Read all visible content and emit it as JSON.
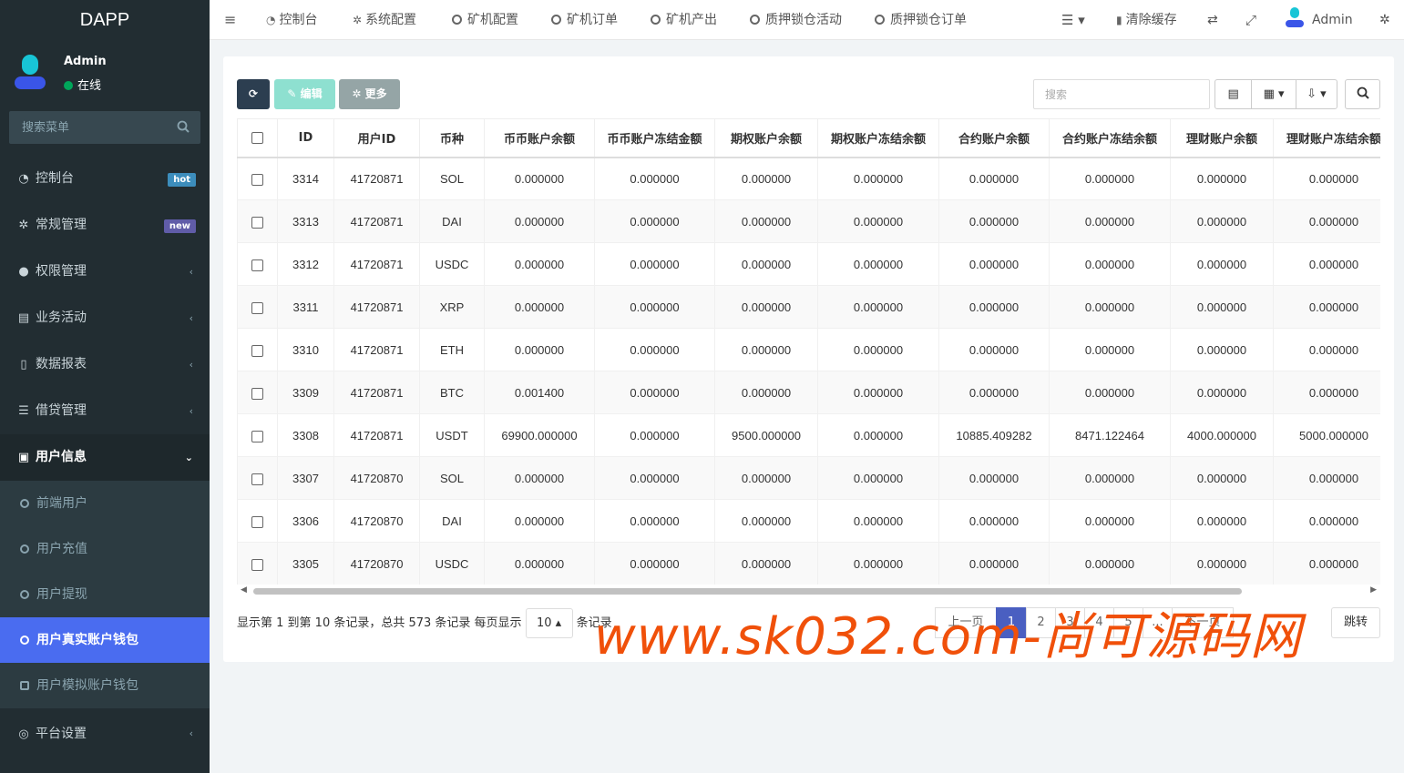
{
  "brand": "DAPP",
  "user": {
    "name": "Admin",
    "status": "在线"
  },
  "sidebar": {
    "search_placeholder": "搜索菜单",
    "items": [
      {
        "label": "控制台",
        "icon": "dashboard-icon",
        "badge": "hot",
        "badge_color": "#3c8dbc"
      },
      {
        "label": "常规管理",
        "icon": "cogs-icon",
        "badge": "new",
        "badge_color": "#605ca8"
      },
      {
        "label": "权限管理",
        "icon": "group-icon"
      },
      {
        "label": "业务活动",
        "icon": "list-alt-icon"
      },
      {
        "label": "数据报表",
        "icon": "file-icon"
      },
      {
        "label": "借贷管理",
        "icon": "list-icon"
      },
      {
        "label": "用户信息",
        "icon": "user-card-icon"
      }
    ],
    "sub_items": [
      {
        "label": "前端用户"
      },
      {
        "label": "用户充值"
      },
      {
        "label": "用户提现"
      },
      {
        "label": "用户真实账户钱包"
      },
      {
        "label": "用户模拟账户钱包"
      }
    ],
    "bottom_item": {
      "label": "平台设置"
    }
  },
  "topnav": {
    "items": [
      "控制台",
      "系统配置",
      "矿机配置",
      "矿机订单",
      "矿机产出",
      "质押锁仓活动",
      "质押锁仓订单"
    ],
    "clear_cache": "清除缓存",
    "admin": "Admin"
  },
  "toolbar": {
    "edit_label": "编辑",
    "more_label": "更多",
    "search_placeholder": "搜索"
  },
  "table": {
    "columns": [
      "ID",
      "用户ID",
      "币种",
      "币币账户余额",
      "币币账户冻结金额",
      "期权账户余额",
      "期权账户冻结余额",
      "合约账户余额",
      "合约账户冻结余额",
      "理财账户余额",
      "理财账户冻结余额"
    ],
    "rows": [
      [
        "3314",
        "41720871",
        "SOL",
        "0.000000",
        "0.000000",
        "0.000000",
        "0.000000",
        "0.000000",
        "0.000000",
        "0.000000",
        "0.000000"
      ],
      [
        "3313",
        "41720871",
        "DAI",
        "0.000000",
        "0.000000",
        "0.000000",
        "0.000000",
        "0.000000",
        "0.000000",
        "0.000000",
        "0.000000"
      ],
      [
        "3312",
        "41720871",
        "USDC",
        "0.000000",
        "0.000000",
        "0.000000",
        "0.000000",
        "0.000000",
        "0.000000",
        "0.000000",
        "0.000000"
      ],
      [
        "3311",
        "41720871",
        "XRP",
        "0.000000",
        "0.000000",
        "0.000000",
        "0.000000",
        "0.000000",
        "0.000000",
        "0.000000",
        "0.000000"
      ],
      [
        "3310",
        "41720871",
        "ETH",
        "0.000000",
        "0.000000",
        "0.000000",
        "0.000000",
        "0.000000",
        "0.000000",
        "0.000000",
        "0.000000"
      ],
      [
        "3309",
        "41720871",
        "BTC",
        "0.001400",
        "0.000000",
        "0.000000",
        "0.000000",
        "0.000000",
        "0.000000",
        "0.000000",
        "0.000000"
      ],
      [
        "3308",
        "41720871",
        "USDT",
        "69900.000000",
        "0.000000",
        "9500.000000",
        "0.000000",
        "10885.409282",
        "8471.122464",
        "4000.000000",
        "5000.000000"
      ],
      [
        "3307",
        "41720870",
        "SOL",
        "0.000000",
        "0.000000",
        "0.000000",
        "0.000000",
        "0.000000",
        "0.000000",
        "0.000000",
        "0.000000"
      ],
      [
        "3306",
        "41720870",
        "DAI",
        "0.000000",
        "0.000000",
        "0.000000",
        "0.000000",
        "0.000000",
        "0.000000",
        "0.000000",
        "0.000000"
      ],
      [
        "3305",
        "41720870",
        "USDC",
        "0.000000",
        "0.000000",
        "0.000000",
        "0.000000",
        "0.000000",
        "0.000000",
        "0.000000",
        "0.000000"
      ]
    ]
  },
  "footer": {
    "info_prefix": "显示第 1 到第 10 条记录，总共 573 条记录 每页显示",
    "page_size": "10",
    "info_suffix": "条记录",
    "pager": [
      "上一页",
      "1",
      "2",
      "3",
      "4",
      "5",
      "...",
      "下一页"
    ],
    "current_page": "1",
    "jump": "跳转"
  },
  "watermark": "www.sk032.com-尚可源码网"
}
